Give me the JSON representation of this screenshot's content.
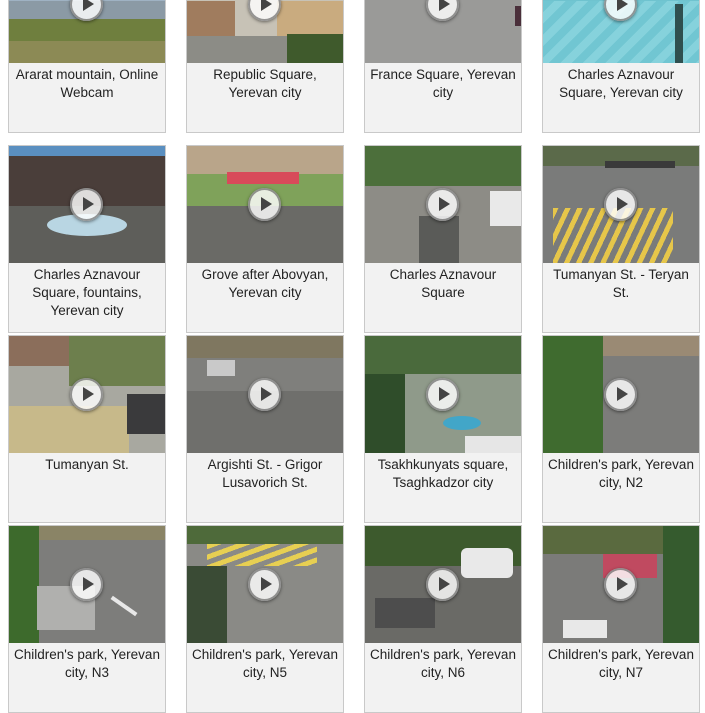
{
  "tiles": [
    {
      "caption": "Ararat mountain, Online Webcam"
    },
    {
      "caption": "Republic Square, Yerevan city"
    },
    {
      "caption": "France Square, Yerevan city"
    },
    {
      "caption": "Charles Aznavour Square, Yerevan city"
    },
    {
      "caption": "Charles Aznavour Square, fountains, Yerevan city"
    },
    {
      "caption": "Grove after Abovyan, Yerevan city"
    },
    {
      "caption": "Charles Aznavour Square"
    },
    {
      "caption": "Tumanyan St. - Teryan St."
    },
    {
      "caption": "Tumanyan St."
    },
    {
      "caption": "Argishti St. - Grigor Lusavorich St."
    },
    {
      "caption": "Tsakhkunyats square, Tsaghkadzor city"
    },
    {
      "caption": "Children's park, Yerevan city, N2"
    },
    {
      "caption": "Children's park, Yerevan city, N3"
    },
    {
      "caption": "Children's park, Yerevan city, N5"
    },
    {
      "caption": "Children's park, Yerevan city, N6"
    },
    {
      "caption": "Children's park, Yerevan city, N7"
    }
  ]
}
